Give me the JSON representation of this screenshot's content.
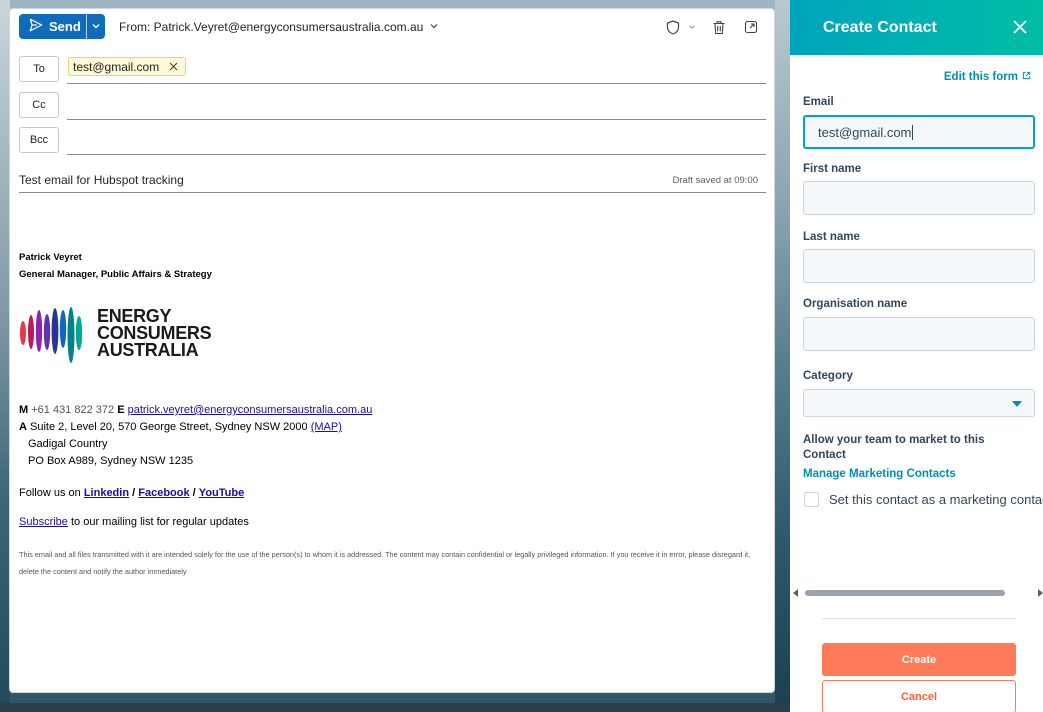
{
  "compose": {
    "send_label": "Send",
    "from_label": "From: Patrick.Veyret@energyconsumersaustralia.com.au",
    "to_label": "To",
    "cc_label": "Cc",
    "bcc_label": "Bcc",
    "to_recipient": "test@gmail.com",
    "subject": "Test email for Hubspot tracking",
    "draft_status": "Draft saved at 09:00"
  },
  "signature": {
    "name": "Patrick Veyret",
    "title": "General Manager, Public Affairs & Strategy",
    "logo_line1": "ENERGY",
    "logo_line2": "CONSUMERS",
    "logo_line3": "AUSTRALIA",
    "mobile_label": "M",
    "mobile": "+61 431 822 372",
    "email_label": "E",
    "email": "patrick.veyret@energyconsumersaustralia.com.au",
    "address_label": "A",
    "address": "Suite 2, Level 20, 570 George Street, Sydney NSW 2000",
    "map_link": "(MAP)",
    "country": "Gadigal Country",
    "po_box": "PO Box A989, Sydney NSW 1235",
    "follow_prefix": "Follow us on",
    "linkedin": "Linkedin",
    "sep": "/",
    "facebook": "Facebook",
    "youtube": "YouTube",
    "subscribe_link": "Subscribe",
    "subscribe_rest": "to our mailing list for regular updates",
    "disclaimer": "This email and all files transmitted with it are intended solely for the use of the person(s) to whom it is addressed. The content may contain confidential or legally privileged information. If you receive it in error, please disregard it, delete the content and notify the author immediately"
  },
  "panel": {
    "title": "Create Contact",
    "edit_form": "Edit this form",
    "email_label": "Email",
    "email_value": "test@gmail.com",
    "first_name_label": "First name",
    "last_name_label": "Last name",
    "org_label": "Organisation name",
    "category_label": "Category",
    "allow_text": "Allow your team to market to this Contact",
    "manage_link": "Manage Marketing Contacts",
    "checkbox_label": "Set this contact as a marketing contact",
    "create_label": "Create",
    "cancel_label": "Cancel"
  },
  "colors": {
    "send_blue": "#0f6cbd",
    "hubspot_teal": "#00a4bd",
    "hubspot_orange": "#ff7a59",
    "link_blue": "#1a0dab"
  }
}
